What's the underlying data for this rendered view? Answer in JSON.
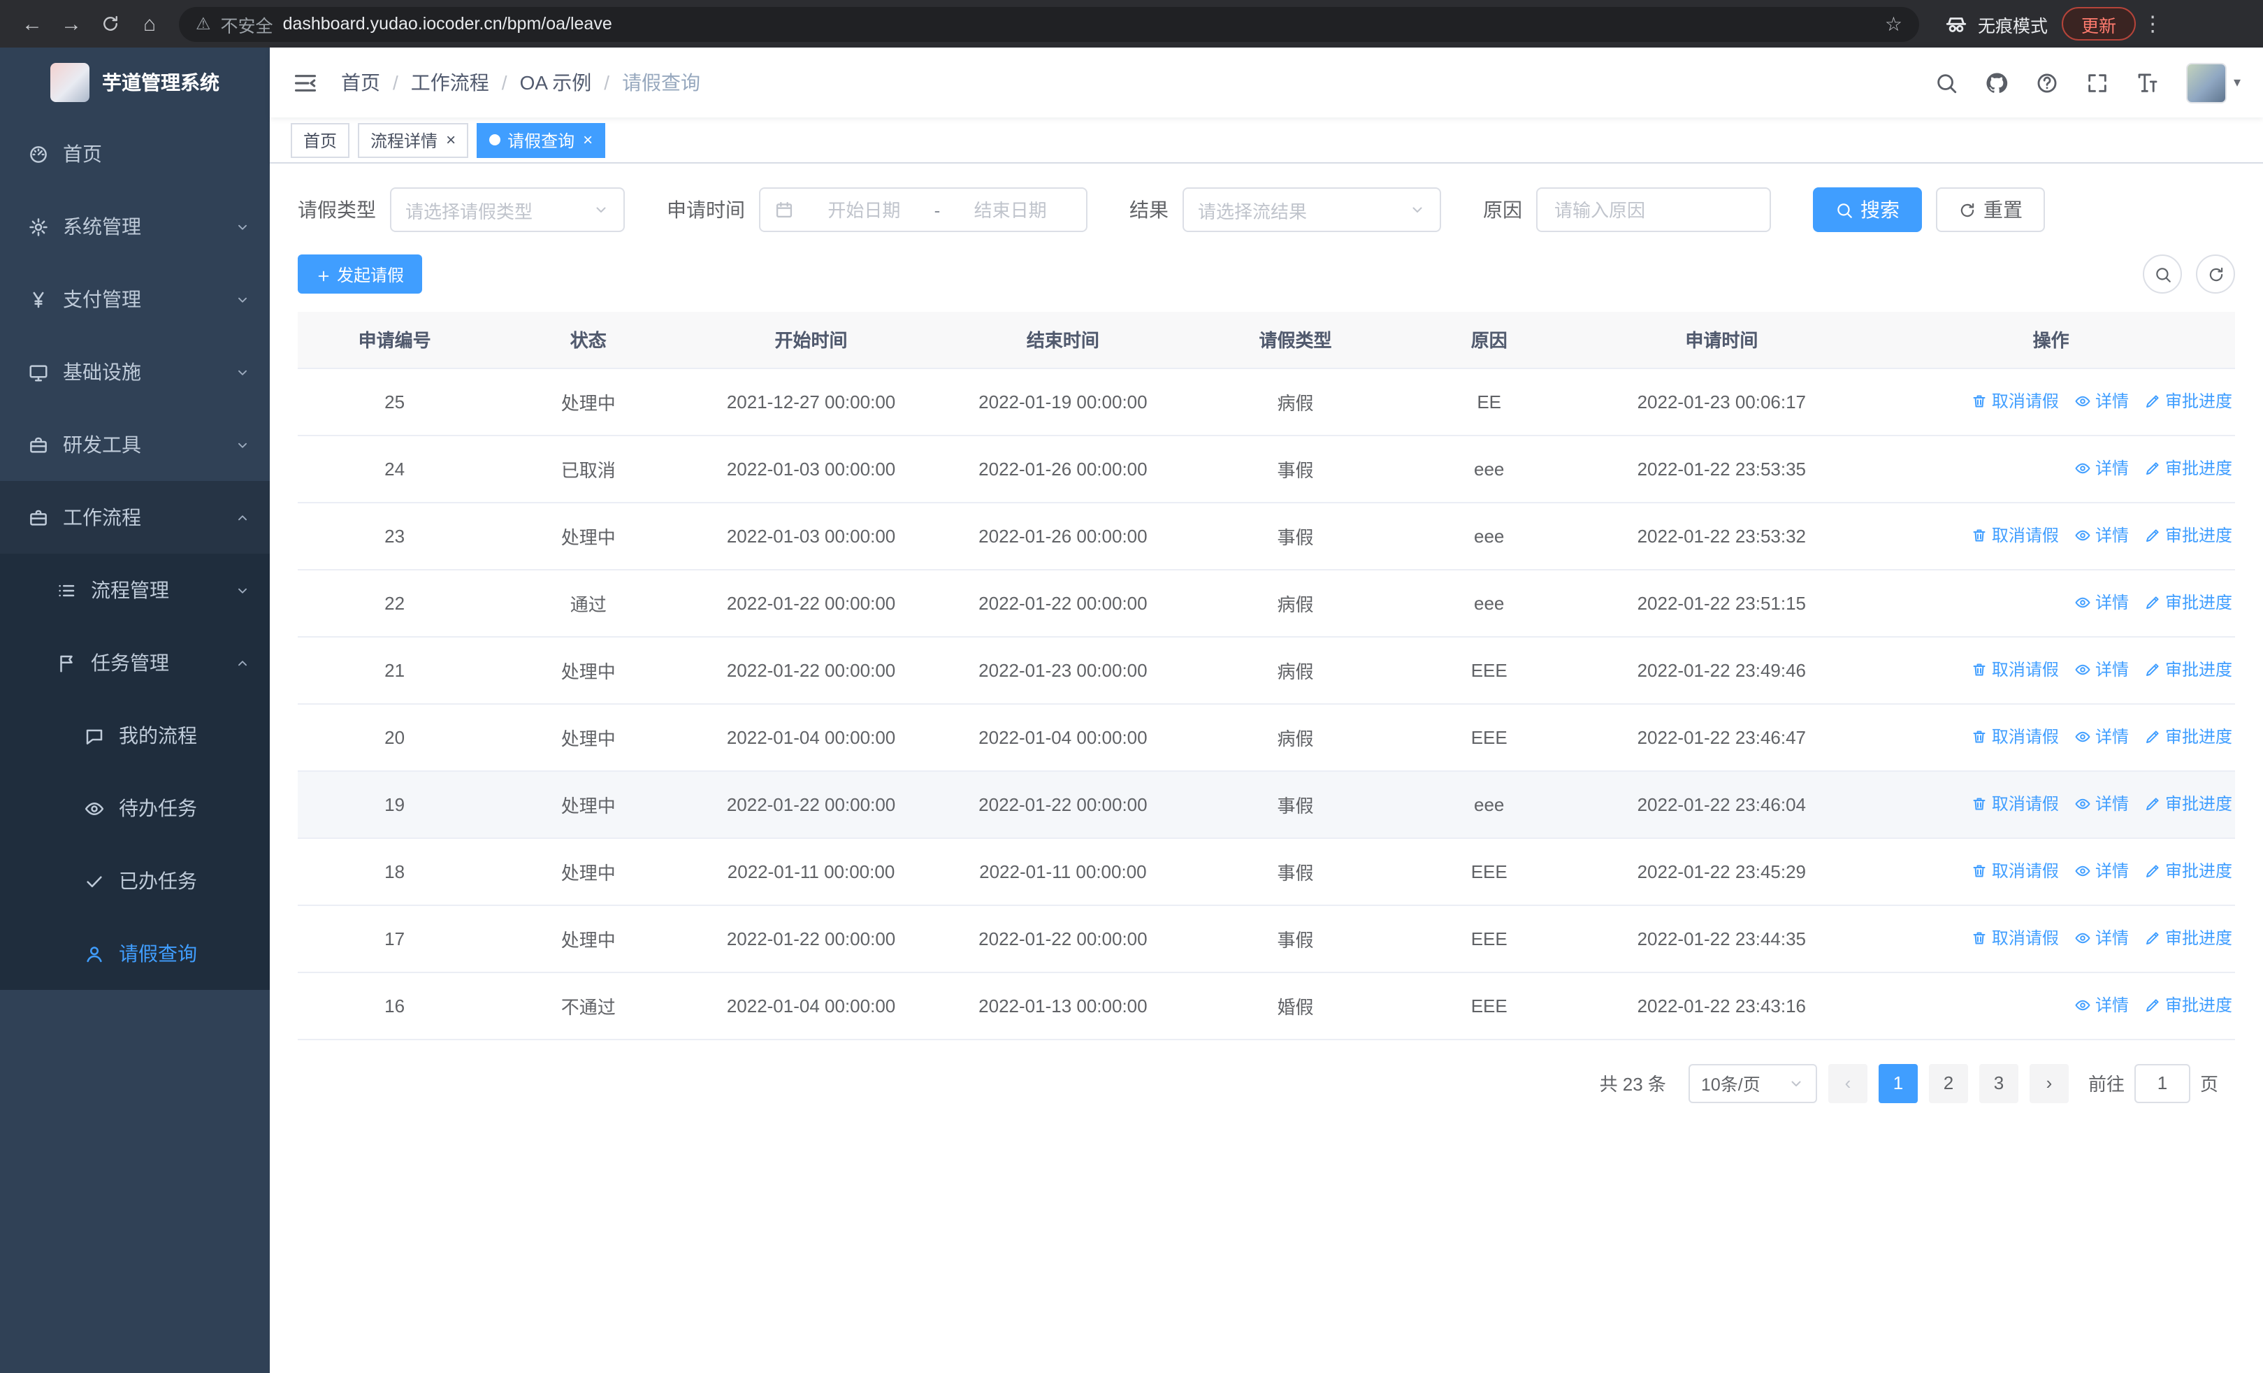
{
  "browser": {
    "back_icon": "←",
    "forward_icon": "→",
    "home_icon": "⌂",
    "security_label": "不安全",
    "url": "dashboard.yudao.iocoder.cn/bpm/oa/leave",
    "star_icon": "☆",
    "warning_icon": "⚠",
    "incognito_label": "无痕模式",
    "update_label": "更新",
    "menu_icon": "⋮"
  },
  "sidebar": {
    "logo_title": "芋道管理系统",
    "menu": [
      {
        "name": "home",
        "label": "首页",
        "icon": "dashboard-icon",
        "level": 1
      },
      {
        "name": "system",
        "label": "系统管理",
        "icon": "gear-icon",
        "level": 1,
        "chevron": "down"
      },
      {
        "name": "payment",
        "label": "支付管理",
        "icon": "yen-icon",
        "level": 1,
        "chevron": "down"
      },
      {
        "name": "infrastructure",
        "label": "基础设施",
        "icon": "monitor-icon",
        "level": 1,
        "chevron": "down"
      },
      {
        "name": "dev-tools",
        "label": "研发工具",
        "icon": "toolbox-icon",
        "level": 1,
        "chevron": "down"
      },
      {
        "name": "workflow",
        "label": "工作流程",
        "icon": "briefcase-icon",
        "level": 1,
        "chevron": "up",
        "expanded": true
      },
      {
        "name": "process-mgmt",
        "label": "流程管理",
        "icon": "list-icon",
        "level": 2,
        "chevron": "down"
      },
      {
        "name": "task-mgmt",
        "label": "任务管理",
        "icon": "flag-icon",
        "level": 2,
        "chevron": "up",
        "expanded": true
      },
      {
        "name": "my-process",
        "label": "我的流程",
        "icon": "chat-icon",
        "level": 3
      },
      {
        "name": "todo-task",
        "label": "待办任务",
        "icon": "eye-icon",
        "level": 3
      },
      {
        "name": "done-task",
        "label": "已办任务",
        "icon": "check-icon",
        "level": 3
      },
      {
        "name": "leave-query",
        "label": "请假查询",
        "icon": "user-icon",
        "level": 3,
        "active": true
      }
    ]
  },
  "header": {
    "breadcrumbs": [
      "首页",
      "工作流程",
      "OA 示例",
      "请假查询"
    ],
    "separator": "/",
    "caret_icon": "▾"
  },
  "tagsbar": {
    "close_icon": "×",
    "tabs": [
      {
        "label": "首页",
        "closable": false,
        "active": false
      },
      {
        "label": "流程详情",
        "closable": true,
        "active": false
      },
      {
        "label": "请假查询",
        "closable": true,
        "active": true
      }
    ]
  },
  "filters": {
    "leave_type_label": "请假类型",
    "leave_type_placeholder": "请选择请假类型",
    "apply_time_label": "申请时间",
    "start_date_placeholder": "开始日期",
    "range_separator": "-",
    "end_date_placeholder": "结束日期",
    "result_label": "结果",
    "result_placeholder": "请选择流结果",
    "reason_label": "原因",
    "reason_placeholder": "请输入原因",
    "search_label": "搜索",
    "reset_label": "重置"
  },
  "toolbar": {
    "create_label": "发起请假"
  },
  "table": {
    "columns": [
      "申请编号",
      "状态",
      "开始时间",
      "结束时间",
      "请假类型",
      "原因",
      "申请时间",
      "操作"
    ],
    "action_labels": {
      "cancel": "取消请假",
      "detail": "详情",
      "progress": "审批进度"
    },
    "rows": [
      {
        "id": "25",
        "status": "处理中",
        "start": "2021-12-27 00:00:00",
        "end": "2022-01-19 00:00:00",
        "type": "病假",
        "reason": "EE",
        "applied": "2022-01-23 00:06:17",
        "actions": [
          "cancel",
          "detail",
          "progress"
        ]
      },
      {
        "id": "24",
        "status": "已取消",
        "start": "2022-01-03 00:00:00",
        "end": "2022-01-26 00:00:00",
        "type": "事假",
        "reason": "eee",
        "applied": "2022-01-22 23:53:35",
        "actions": [
          "detail",
          "progress"
        ]
      },
      {
        "id": "23",
        "status": "处理中",
        "start": "2022-01-03 00:00:00",
        "end": "2022-01-26 00:00:00",
        "type": "事假",
        "reason": "eee",
        "applied": "2022-01-22 23:53:32",
        "actions": [
          "cancel",
          "detail",
          "progress"
        ]
      },
      {
        "id": "22",
        "status": "通过",
        "start": "2022-01-22 00:00:00",
        "end": "2022-01-22 00:00:00",
        "type": "病假",
        "reason": "eee",
        "applied": "2022-01-22 23:51:15",
        "actions": [
          "detail",
          "progress"
        ]
      },
      {
        "id": "21",
        "status": "处理中",
        "start": "2022-01-22 00:00:00",
        "end": "2022-01-23 00:00:00",
        "type": "病假",
        "reason": "EEE",
        "applied": "2022-01-22 23:49:46",
        "actions": [
          "cancel",
          "detail",
          "progress"
        ]
      },
      {
        "id": "20",
        "status": "处理中",
        "start": "2022-01-04 00:00:00",
        "end": "2022-01-04 00:00:00",
        "type": "病假",
        "reason": "EEE",
        "applied": "2022-01-22 23:46:47",
        "actions": [
          "cancel",
          "detail",
          "progress"
        ]
      },
      {
        "id": "19",
        "status": "处理中",
        "start": "2022-01-22 00:00:00",
        "end": "2022-01-22 00:00:00",
        "type": "事假",
        "reason": "eee",
        "applied": "2022-01-22 23:46:04",
        "actions": [
          "cancel",
          "detail",
          "progress"
        ],
        "highlighted": true
      },
      {
        "id": "18",
        "status": "处理中",
        "start": "2022-01-11 00:00:00",
        "end": "2022-01-11 00:00:00",
        "type": "事假",
        "reason": "EEE",
        "applied": "2022-01-22 23:45:29",
        "actions": [
          "cancel",
          "detail",
          "progress"
        ]
      },
      {
        "id": "17",
        "status": "处理中",
        "start": "2022-01-22 00:00:00",
        "end": "2022-01-22 00:00:00",
        "type": "事假",
        "reason": "EEE",
        "applied": "2022-01-22 23:44:35",
        "actions": [
          "cancel",
          "detail",
          "progress"
        ]
      },
      {
        "id": "16",
        "status": "不通过",
        "start": "2022-01-04 00:00:00",
        "end": "2022-01-13 00:00:00",
        "type": "婚假",
        "reason": "EEE",
        "applied": "2022-01-22 23:43:16",
        "actions": [
          "detail",
          "progress"
        ]
      }
    ]
  },
  "pagination": {
    "total_label": "共 23 条",
    "page_size_label": "10条/页",
    "prev_icon": "‹",
    "next_icon": "›",
    "pages": [
      "1",
      "2",
      "3"
    ],
    "active_page": "1",
    "goto_label": "前往",
    "goto_value": "1",
    "unit_label": "页"
  },
  "colors": {
    "accent": "#409eff",
    "sidebar_bg": "#304156",
    "sidebar_submenu_bg": "#1f2d3d",
    "table_header_bg": "#f8f8f9",
    "update_button_text": "#ff7b6e"
  }
}
